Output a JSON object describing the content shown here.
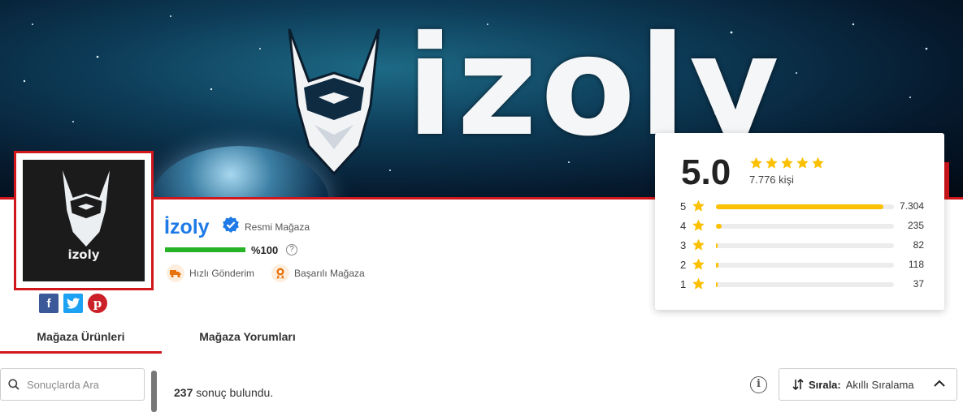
{
  "banner": {
    "wordmark": "izoly"
  },
  "logo": {
    "text": "izoly"
  },
  "social": {
    "facebook_glyph": "f",
    "pinterest_glyph": "p"
  },
  "store": {
    "name": "İzoly",
    "official_label": "Resmi Mağaza",
    "rating_percent": "%100",
    "rating_fraction": 1.0,
    "help_glyph": "?",
    "badges": [
      {
        "label": "Hızlı Gönderim",
        "icon": "truck-icon"
      },
      {
        "label": "Başarılı Mağaza",
        "icon": "award-icon"
      }
    ]
  },
  "rating_card": {
    "score": "5.0",
    "reviewers": "7.776 kişi",
    "distribution": [
      {
        "stars": "5",
        "count": "7.304",
        "fraction": 0.94
      },
      {
        "stars": "4",
        "count": "235",
        "fraction": 0.03
      },
      {
        "stars": "3",
        "count": "82",
        "fraction": 0.011
      },
      {
        "stars": "2",
        "count": "118",
        "fraction": 0.015
      },
      {
        "stars": "1",
        "count": "37",
        "fraction": 0.005
      }
    ]
  },
  "tabs": [
    {
      "label": "Mağaza Ürünleri",
      "active": true
    },
    {
      "label": "Mağaza Yorumları",
      "active": false
    }
  ],
  "search": {
    "placeholder": "Sonuçlarda Ara"
  },
  "results": {
    "count": "237",
    "suffix": " sonuç bulundu."
  },
  "sort": {
    "label": "Sırala:",
    "value": "Akıllı Sıralama"
  },
  "info_glyph": "i",
  "colors": {
    "accent_red": "#d1161c",
    "brand_blue": "#1e7ae6",
    "star_yellow": "#fbc000",
    "rating_green": "#27b327"
  }
}
